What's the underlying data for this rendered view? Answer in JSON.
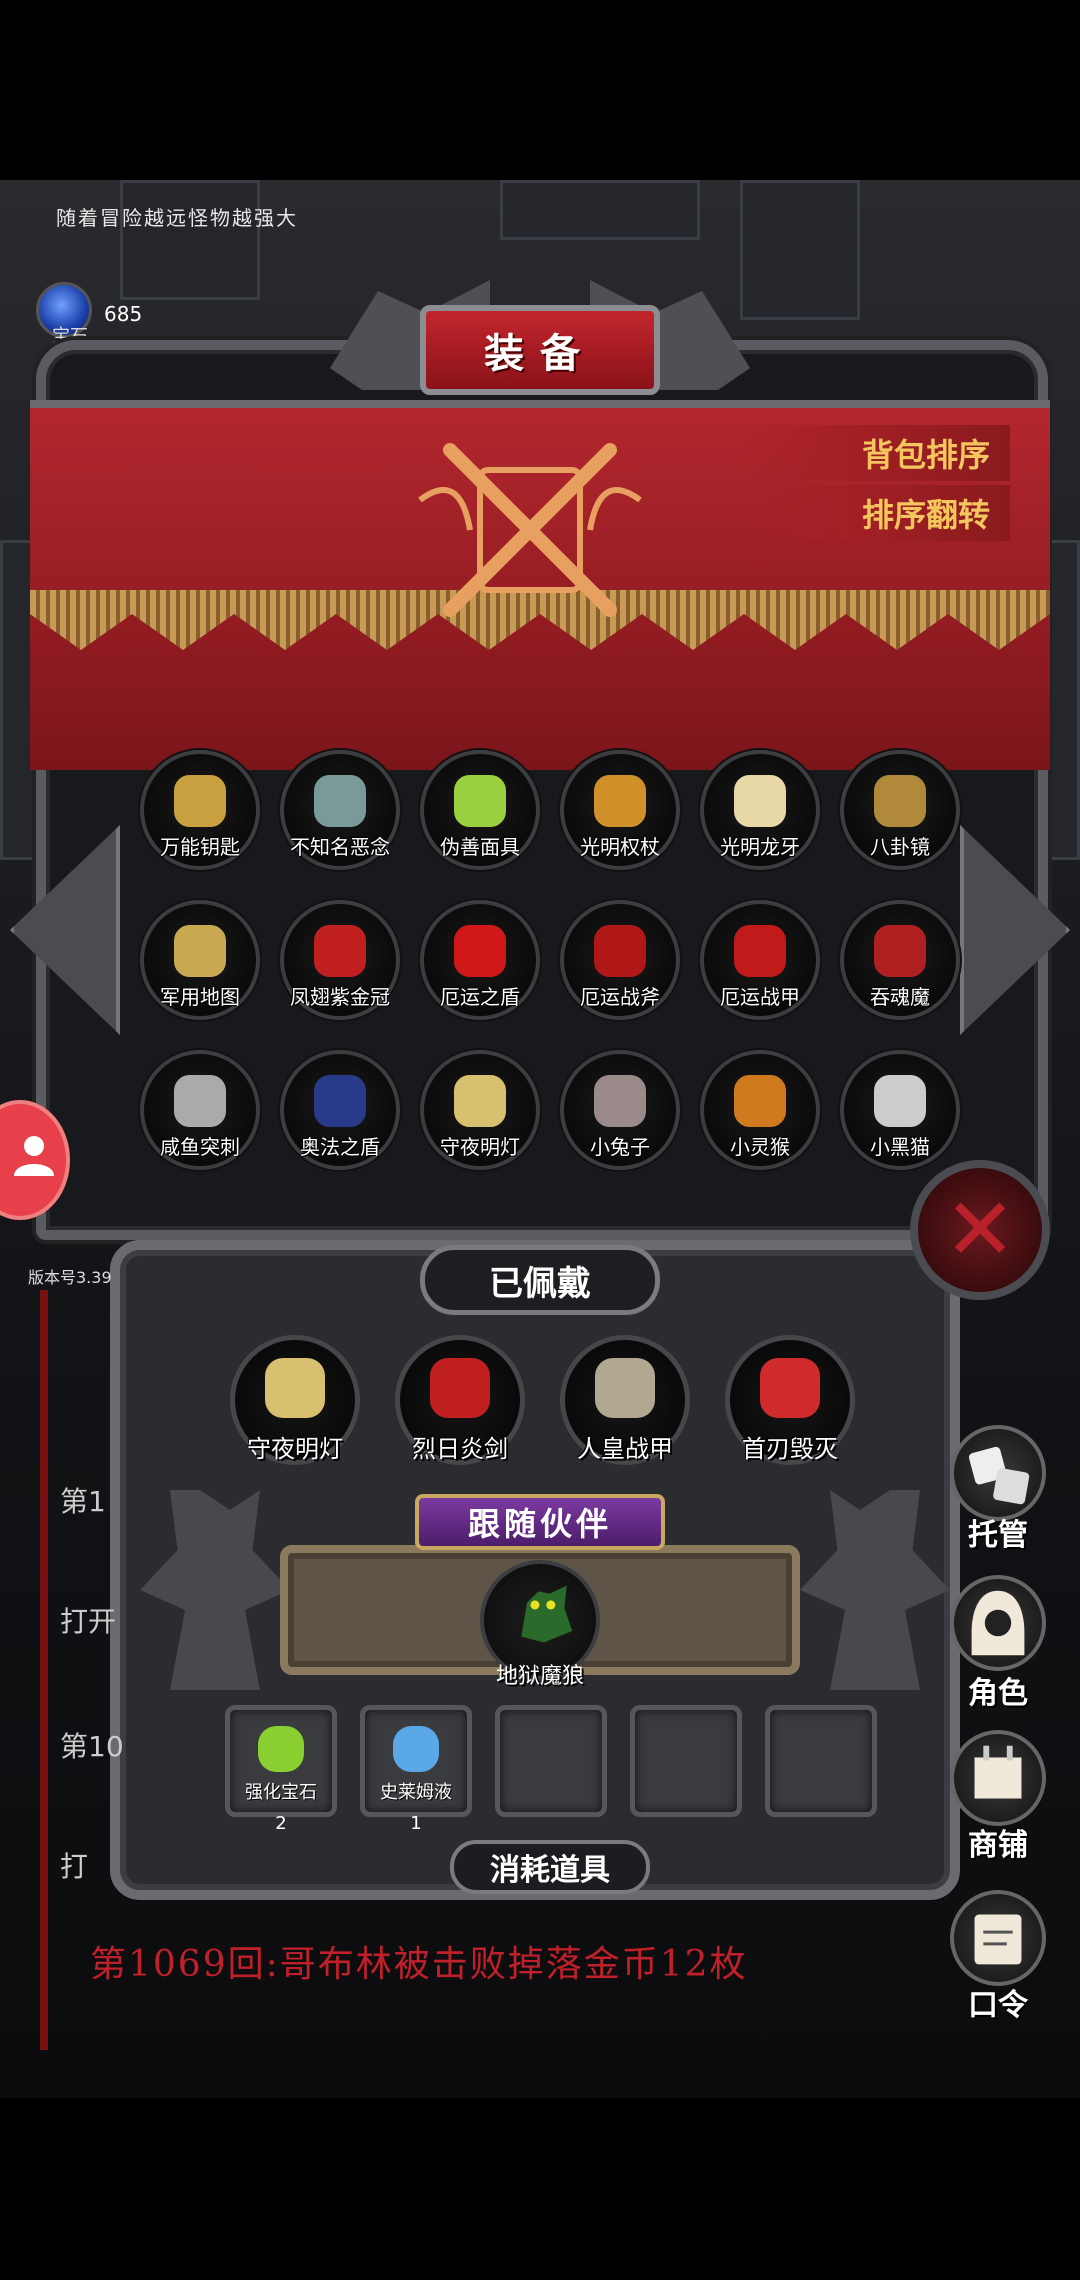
{
  "hud": {
    "hint": "随着冒险越远怪物越强大",
    "gem_label": "宝石",
    "gem_count": "685",
    "version": "版本号3.39"
  },
  "panel": {
    "title": "装备",
    "sort_bag": "背包排序",
    "sort_reverse": "排序翻转"
  },
  "inventory": [
    {
      "label": "万能钥匙",
      "icon": "key-icon",
      "color": "#c9a040"
    },
    {
      "label": "不知名恶念",
      "icon": "ghost-icon",
      "color": "#7a9a9a"
    },
    {
      "label": "伪善面具",
      "icon": "mask-icon",
      "color": "#9ad040"
    },
    {
      "label": "光明权杖",
      "icon": "scepter-icon",
      "color": "#d0902a"
    },
    {
      "label": "光明龙牙",
      "icon": "fang-icon",
      "color": "#e8d8a8"
    },
    {
      "label": "八卦镜",
      "icon": "bagua-mirror-icon",
      "color": "#b08a3a"
    },
    {
      "label": "军用地图",
      "icon": "map-icon",
      "color": "#c8a850"
    },
    {
      "label": "凤翅紫金冠",
      "icon": "crown-icon",
      "color": "#c02020"
    },
    {
      "label": "厄运之盾",
      "icon": "shield-icon",
      "color": "#d01818"
    },
    {
      "label": "厄运战斧",
      "icon": "axe-icon",
      "color": "#b01818"
    },
    {
      "label": "厄运战甲",
      "icon": "armor-icon",
      "color": "#c01a1a"
    },
    {
      "label": "吞魂魔",
      "icon": "demon-icon",
      "color": "#b02020"
    },
    {
      "label": "咸鱼突刺",
      "icon": "spear-icon",
      "color": "#aaaaaa"
    },
    {
      "label": "奥法之盾",
      "icon": "arcane-shield-icon",
      "color": "#2a3a8a"
    },
    {
      "label": "守夜明灯",
      "icon": "lantern-icon",
      "color": "#d8c070"
    },
    {
      "label": "小兔子",
      "icon": "rabbit-icon",
      "color": "#9a8a8a"
    },
    {
      "label": "小灵猴",
      "icon": "monkey-icon",
      "color": "#d07a20"
    },
    {
      "label": "小黑猫",
      "icon": "cat-icon",
      "color": "#cccccc"
    }
  ],
  "equipped": {
    "title": "已佩戴",
    "items": [
      {
        "label": "守夜明灯",
        "icon": "lantern-icon",
        "color": "#d8c070"
      },
      {
        "label": "烈日炎剑",
        "icon": "sword-icon",
        "color": "#c02020"
      },
      {
        "label": "人皇战甲",
        "icon": "knight-armor-icon",
        "color": "#b0a890"
      },
      {
        "label": "首刃毁灭",
        "icon": "blades-icon",
        "color": "#d02a2a"
      }
    ]
  },
  "companion": {
    "title": "跟随伙伴",
    "label": "地狱魔狼",
    "icon": "hell-wolf-icon",
    "color": "#2a6a2a"
  },
  "consumables": {
    "title": "消耗道具",
    "slots": [
      {
        "label": "强化宝石",
        "count": "2",
        "icon": "gem-cluster-icon",
        "color": "#8ad030"
      },
      {
        "label": "史莱姆液",
        "count": "1",
        "icon": "potion-icon",
        "color": "#5aa8e8"
      },
      {
        "label": "",
        "count": "",
        "icon": "",
        "color": ""
      },
      {
        "label": "",
        "count": "",
        "icon": "",
        "color": ""
      },
      {
        "label": "",
        "count": "",
        "icon": "",
        "color": ""
      }
    ]
  },
  "side": {
    "auto": "托管",
    "role": "角色",
    "shop": "商铺",
    "code": "口令"
  },
  "log": {
    "latest": "第1069回:哥布林被击败掉落金币12枚",
    "line1": "第1",
    "line2": "打开",
    "line3": "第10",
    "line4": "打"
  }
}
